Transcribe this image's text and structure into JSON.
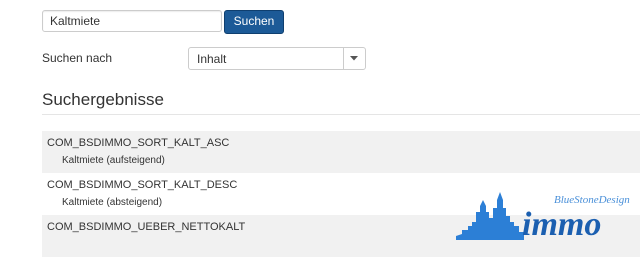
{
  "search": {
    "value": "Kaltmiete",
    "button_label": "Suchen"
  },
  "filter": {
    "label": "Suchen nach",
    "selected": "Inhalt"
  },
  "results": {
    "heading": "Suchergebnisse",
    "items": [
      {
        "title": "COM_BSDIMMO_SORT_KALT_ASC",
        "description": "Kaltmiete (aufsteigend)"
      },
      {
        "title": "COM_BSDIMMO_SORT_KALT_DESC",
        "description": "Kaltmiete (absteigend)"
      },
      {
        "title": "COM_BSDIMMO_UEBER_NETTOKALT",
        "description": ""
      }
    ]
  },
  "logo": {
    "brand": "BlueStoneDesign",
    "word": "immo"
  },
  "colors": {
    "accent": "#1c5a97",
    "row_shade": "#f1f1f1",
    "logo_blue": "#2c7fd6"
  }
}
